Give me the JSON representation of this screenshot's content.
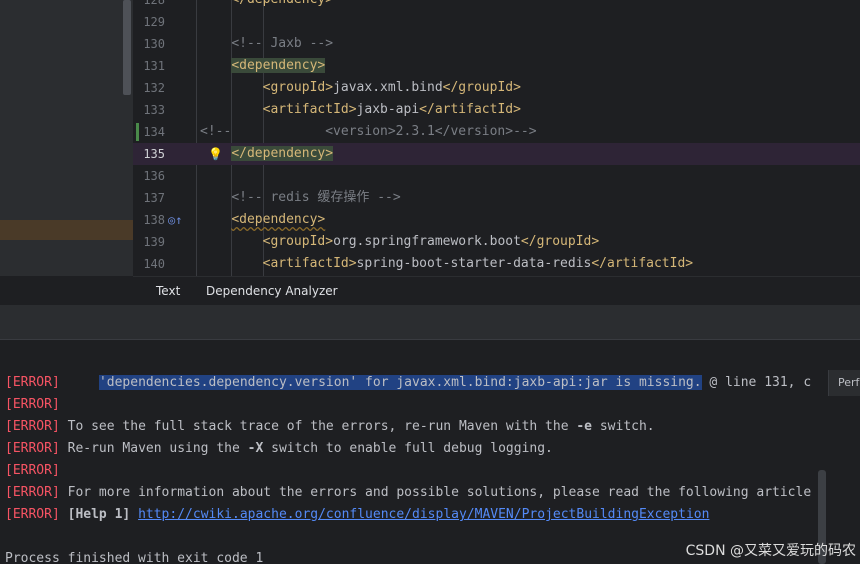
{
  "editor": {
    "lines": [
      {
        "num": "128",
        "segments": [
          {
            "t": "    ",
            "c": "txt"
          },
          {
            "t": "</dependency>",
            "c": "tag"
          }
        ]
      },
      {
        "num": "129",
        "segments": []
      },
      {
        "num": "130",
        "segments": [
          {
            "t": "    ",
            "c": "txt"
          },
          {
            "t": "<!-- Jaxb -->",
            "c": "cmt"
          }
        ]
      },
      {
        "num": "131",
        "segments": [
          {
            "t": "    ",
            "c": "txt"
          },
          {
            "t": "<dependency>",
            "c": "tag tagbg"
          }
        ]
      },
      {
        "num": "132",
        "segments": [
          {
            "t": "        ",
            "c": "txt"
          },
          {
            "t": "<groupId>",
            "c": "tag"
          },
          {
            "t": "javax.xml.bind",
            "c": "txt"
          },
          {
            "t": "</groupId>",
            "c": "tag"
          }
        ]
      },
      {
        "num": "133",
        "segments": [
          {
            "t": "        ",
            "c": "txt"
          },
          {
            "t": "<artifactId>",
            "c": "tag"
          },
          {
            "t": "jaxb-api",
            "c": "txt"
          },
          {
            "t": "</artifactId>",
            "c": "tag"
          }
        ]
      },
      {
        "num": "134",
        "segments": [
          {
            "t": "<!--",
            "c": "cmt"
          },
          {
            "t": "            <version>2.3.1</version>-->",
            "c": "cmt"
          }
        ]
      },
      {
        "num": "135",
        "segments": [
          {
            "t": "    ",
            "c": "txt"
          },
          {
            "t": "</dependency>",
            "c": "tag tagbg"
          }
        ]
      },
      {
        "num": "136",
        "segments": []
      },
      {
        "num": "137",
        "segments": [
          {
            "t": "    ",
            "c": "txt"
          },
          {
            "t": "<!-- redis 缓存操作 -->",
            "c": "cmt"
          }
        ]
      },
      {
        "num": "138",
        "segments": [
          {
            "t": "    ",
            "c": "txt"
          },
          {
            "t": "<dependency>",
            "c": "tag squig"
          }
        ]
      },
      {
        "num": "139",
        "segments": [
          {
            "t": "        ",
            "c": "txt"
          },
          {
            "t": "<groupId>",
            "c": "tag"
          },
          {
            "t": "org.springframework.boot",
            "c": "txt"
          },
          {
            "t": "</groupId>",
            "c": "tag"
          }
        ]
      },
      {
        "num": "140",
        "segments": [
          {
            "t": "        ",
            "c": "txt"
          },
          {
            "t": "<artifactId>",
            "c": "tag"
          },
          {
            "t": "spring-boot-starter-data-redis",
            "c": "txt"
          },
          {
            "t": "</artifactId>",
            "c": "tag"
          }
        ]
      }
    ]
  },
  "tabs": {
    "text": "Text",
    "dependency_analyzer": "Dependency Analyzer"
  },
  "console": {
    "lines": [
      [
        {
          "t": "[ERROR]",
          "c": "err"
        },
        {
          "t": "     ",
          "c": ""
        },
        {
          "t": "'dependencies.dependency.version' for javax.xml.bind:jaxb-api:jar is missing.",
          "c": "sel"
        },
        {
          "t": " @ line 131, c",
          "c": ""
        }
      ],
      [
        {
          "t": "[ERROR]",
          "c": "err"
        }
      ],
      [
        {
          "t": "[ERROR]",
          "c": "err"
        },
        {
          "t": " To see the full stack trace of the errors, re-run Maven with the ",
          "c": ""
        },
        {
          "t": "-e",
          "c": "bold"
        },
        {
          "t": " switch.",
          "c": ""
        }
      ],
      [
        {
          "t": "[ERROR]",
          "c": "err"
        },
        {
          "t": " Re-run Maven using the ",
          "c": ""
        },
        {
          "t": "-X",
          "c": "bold"
        },
        {
          "t": " switch to enable full debug logging.",
          "c": ""
        }
      ],
      [
        {
          "t": "[ERROR]",
          "c": "err"
        }
      ],
      [
        {
          "t": "[ERROR]",
          "c": "err"
        },
        {
          "t": " For more information about the errors and possible solutions, please read the following article",
          "c": ""
        }
      ],
      [
        {
          "t": "[ERROR]",
          "c": "err"
        },
        {
          "t": " ",
          "c": ""
        },
        {
          "t": "[Help 1]",
          "c": "bold"
        },
        {
          "t": " ",
          "c": ""
        },
        {
          "t": "http://cwiki.apache.org/confluence/display/MAVEN/ProjectBuildingException",
          "c": "link"
        }
      ],
      [],
      [
        {
          "t": "Process finished with exit code 1",
          "c": ""
        }
      ]
    ]
  },
  "side_panel_label": "Perf",
  "watermark": "CSDN @又菜又爱玩的码农"
}
